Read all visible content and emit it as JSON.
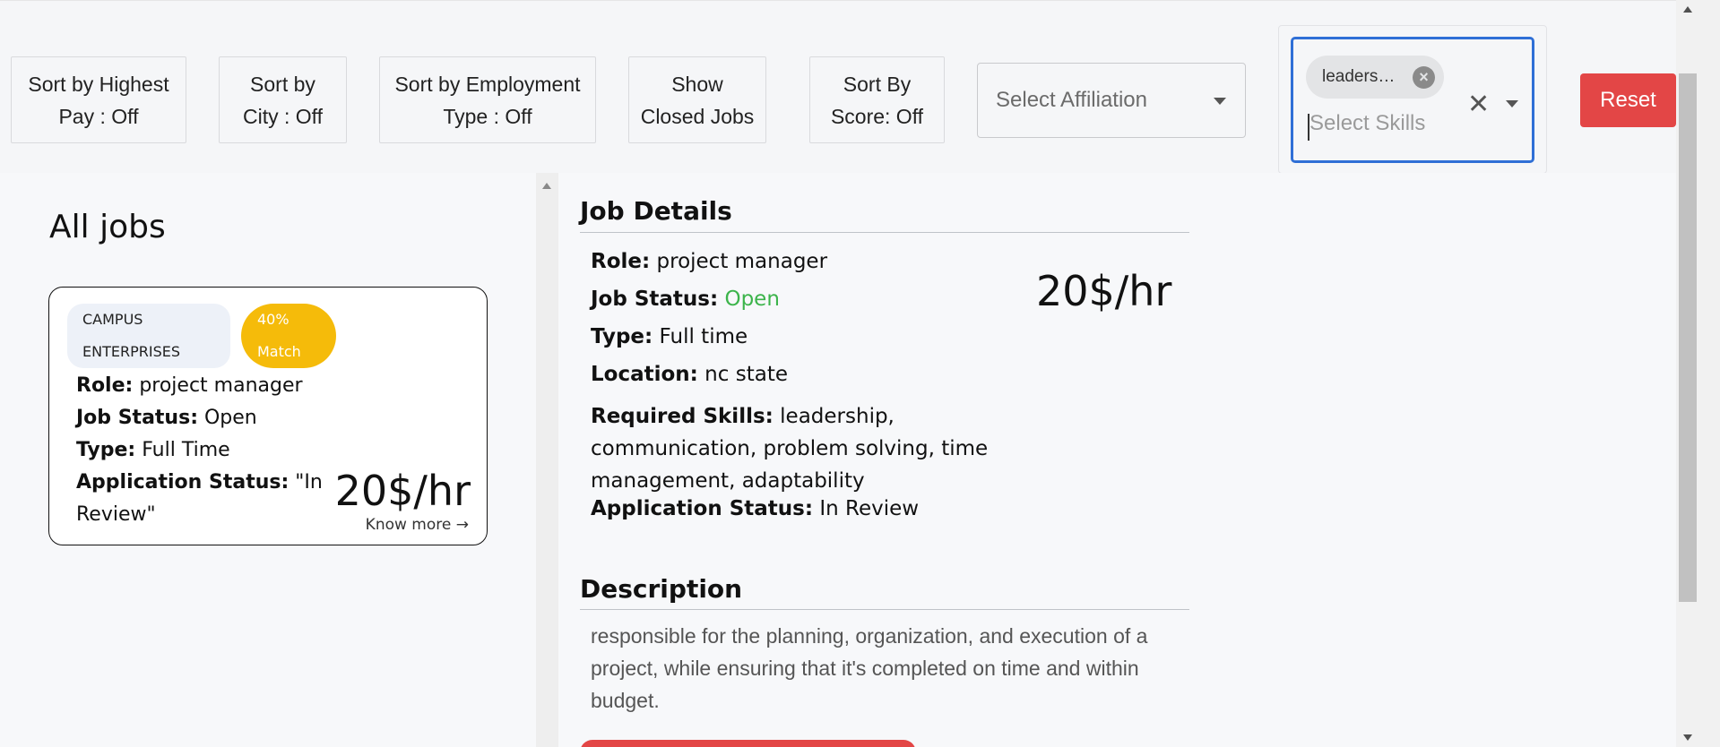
{
  "filters": {
    "sort_highest_pay": [
      "Sort by Highest",
      "Pay : Off"
    ],
    "sort_city": [
      "Sort by",
      "City : Off"
    ],
    "sort_employment": [
      "Sort by Employment",
      "Type : Off"
    ],
    "show_closed": [
      "Show",
      "Closed Jobs"
    ],
    "sort_score": [
      "Sort By",
      "Score: Off"
    ],
    "affiliation_placeholder": "Select Affiliation",
    "skills": {
      "selected_chip": "leaders…",
      "placeholder": "Select Skills"
    },
    "reset_label": "Reset"
  },
  "list": {
    "heading": "All jobs",
    "cards": [
      {
        "company": [
          "CAMPUS",
          "ENTERPRISES"
        ],
        "match": [
          "40%",
          "Match"
        ],
        "role_label": "Role:",
        "role": " project manager",
        "status_label": "Job Status:",
        "status": " Open",
        "type_label": "Type:",
        "type": " Full Time",
        "app_status_label": "Application Status:",
        "app_status_line1": " \"In",
        "app_status_line2": "Review\"",
        "pay": "20$/hr",
        "know_more": "Know more →"
      }
    ]
  },
  "details": {
    "title": "Job Details",
    "role_label": "Role:",
    "role": " project manager",
    "status_label": "Job Status:",
    "status": " Open",
    "type_label": "Type:",
    "type": " Full time",
    "location_label": "Location:",
    "location": " nc state",
    "skills_label": "Required Skills:",
    "skills": " leadership, communication, problem solving, time management, adaptability",
    "app_status_label": "Application Status:",
    "app_status": " In Review",
    "pay": "20$/hr",
    "description_title": "Description",
    "description": "responsible for the planning, organization, and execution of a project, while ensuring that it's completed on time and within budget."
  },
  "colors": {
    "accent_red": "#e34646",
    "match_yellow": "#f5bb0a",
    "open_green": "#3cb44b",
    "focus_blue": "#2f6fd6"
  }
}
